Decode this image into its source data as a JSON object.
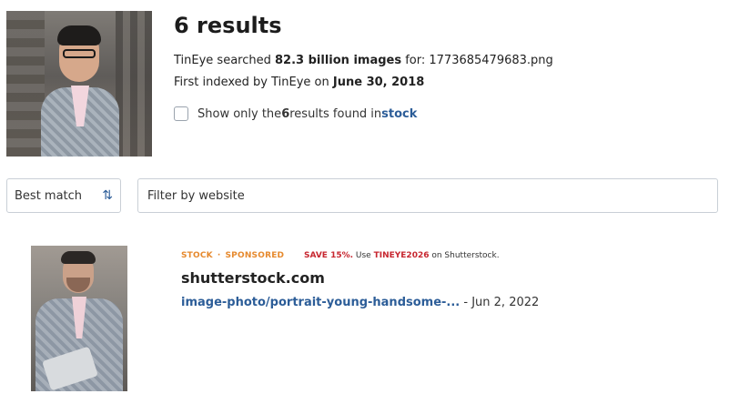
{
  "summary": {
    "results_count_text": "6 results",
    "searched_prefix": "TinEye searched ",
    "searched_count": "82.3 billion images",
    "searched_middle": " for: ",
    "filename": "1773685479683.png",
    "indexed_prefix": "First indexed by TinEye on ",
    "indexed_date": "June 30, 2018",
    "stock_filter": {
      "prefix": "Show only the ",
      "count": "6",
      "middle": " results found in ",
      "link": "stock"
    }
  },
  "toolbar": {
    "sort_label": "Best match",
    "sort_icon": "sort-up-down",
    "filter_placeholder": "Filter by website"
  },
  "results": [
    {
      "tags": [
        "STOCK",
        "SPONSORED"
      ],
      "promo_save": "SAVE 15%.",
      "promo_middle": " Use ",
      "promo_code": "TINEYE2026",
      "promo_suffix": " on Shutterstock.",
      "site": "shutterstock.com",
      "link": "image-photo/portrait-young-handsome-...",
      "date": "- Jun 2, 2022"
    }
  ]
}
